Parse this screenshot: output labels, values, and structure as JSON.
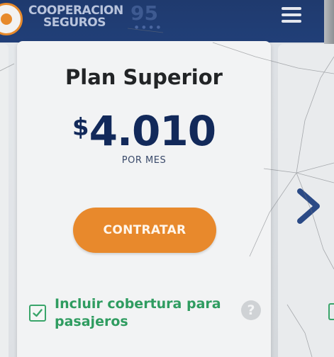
{
  "header": {
    "brand": "COOPERACION SEGUROS",
    "badge": "95",
    "menu_icon": "hamburger-icon"
  },
  "plan": {
    "title": "Plan Superior",
    "currency": "$",
    "amount": "4.010",
    "period": "POR MES",
    "cta_label": "CONTRATAR"
  },
  "coverage": {
    "label": "Incluir cobertura para pasajeros",
    "checked": true,
    "help_icon": "question-icon",
    "help_glyph": "?"
  },
  "carousel": {
    "next_icon": "chevron-right-icon"
  },
  "colors": {
    "header": "#213f78",
    "price": "#12295a",
    "cta": "#e8892c",
    "check": "#2f9c60"
  }
}
